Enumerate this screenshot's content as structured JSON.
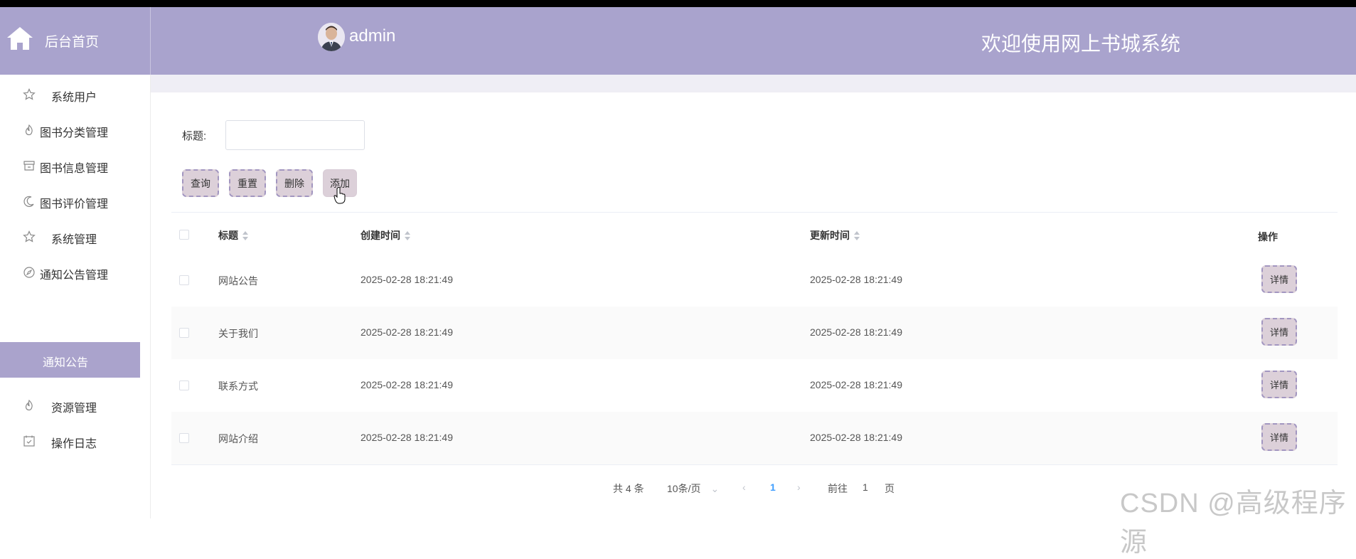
{
  "header": {
    "home_label": "后台首页",
    "username": "admin",
    "welcome": "欢迎使用网上书城系统",
    "color": "#a9a3cd"
  },
  "sidebar": {
    "items": [
      {
        "label": "系统用户",
        "icon": "star-icon"
      },
      {
        "label": "图书分类管理",
        "icon": "fire-icon"
      },
      {
        "label": "图书信息管理",
        "icon": "shop-icon"
      },
      {
        "label": "图书评价管理",
        "icon": "moon-icon"
      },
      {
        "label": "系统管理",
        "icon": "star-icon"
      },
      {
        "label": "通知公告管理",
        "icon": "compass-icon"
      },
      {
        "label": "通知公告",
        "active": true
      },
      {
        "label": "资源管理",
        "icon": "fire-icon"
      },
      {
        "label": "操作日志",
        "icon": "calendar-check-icon"
      }
    ],
    "active_color": "#aaa3cc"
  },
  "search": {
    "label": "标题:",
    "value": "",
    "placeholder": ""
  },
  "actions": {
    "query": "查询",
    "reset": "重置",
    "delete": "删除",
    "add": "添加"
  },
  "table": {
    "columns": {
      "title": "标题",
      "created": "创建时间",
      "updated": "更新时间",
      "ops": "操作"
    },
    "rows": [
      {
        "title": "网站公告",
        "created": "2025-02-28 18:21:49",
        "updated": "2025-02-28 18:21:49",
        "action": "详情"
      },
      {
        "title": "关于我们",
        "created": "2025-02-28 18:21:49",
        "updated": "2025-02-28 18:21:49",
        "action": "详情"
      },
      {
        "title": "联系方式",
        "created": "2025-02-28 18:21:49",
        "updated": "2025-02-28 18:21:49",
        "action": "详情"
      },
      {
        "title": "网站介绍",
        "created": "2025-02-28 18:21:49",
        "updated": "2025-02-28 18:21:49",
        "action": "详情"
      }
    ]
  },
  "pagination": {
    "total": "共 4 条",
    "page_size": "10条/页",
    "current_page": "1",
    "goto_prefix": "前往",
    "goto_value": "1",
    "goto_suffix": "页"
  },
  "watermark": "CSDN @高级程序源"
}
